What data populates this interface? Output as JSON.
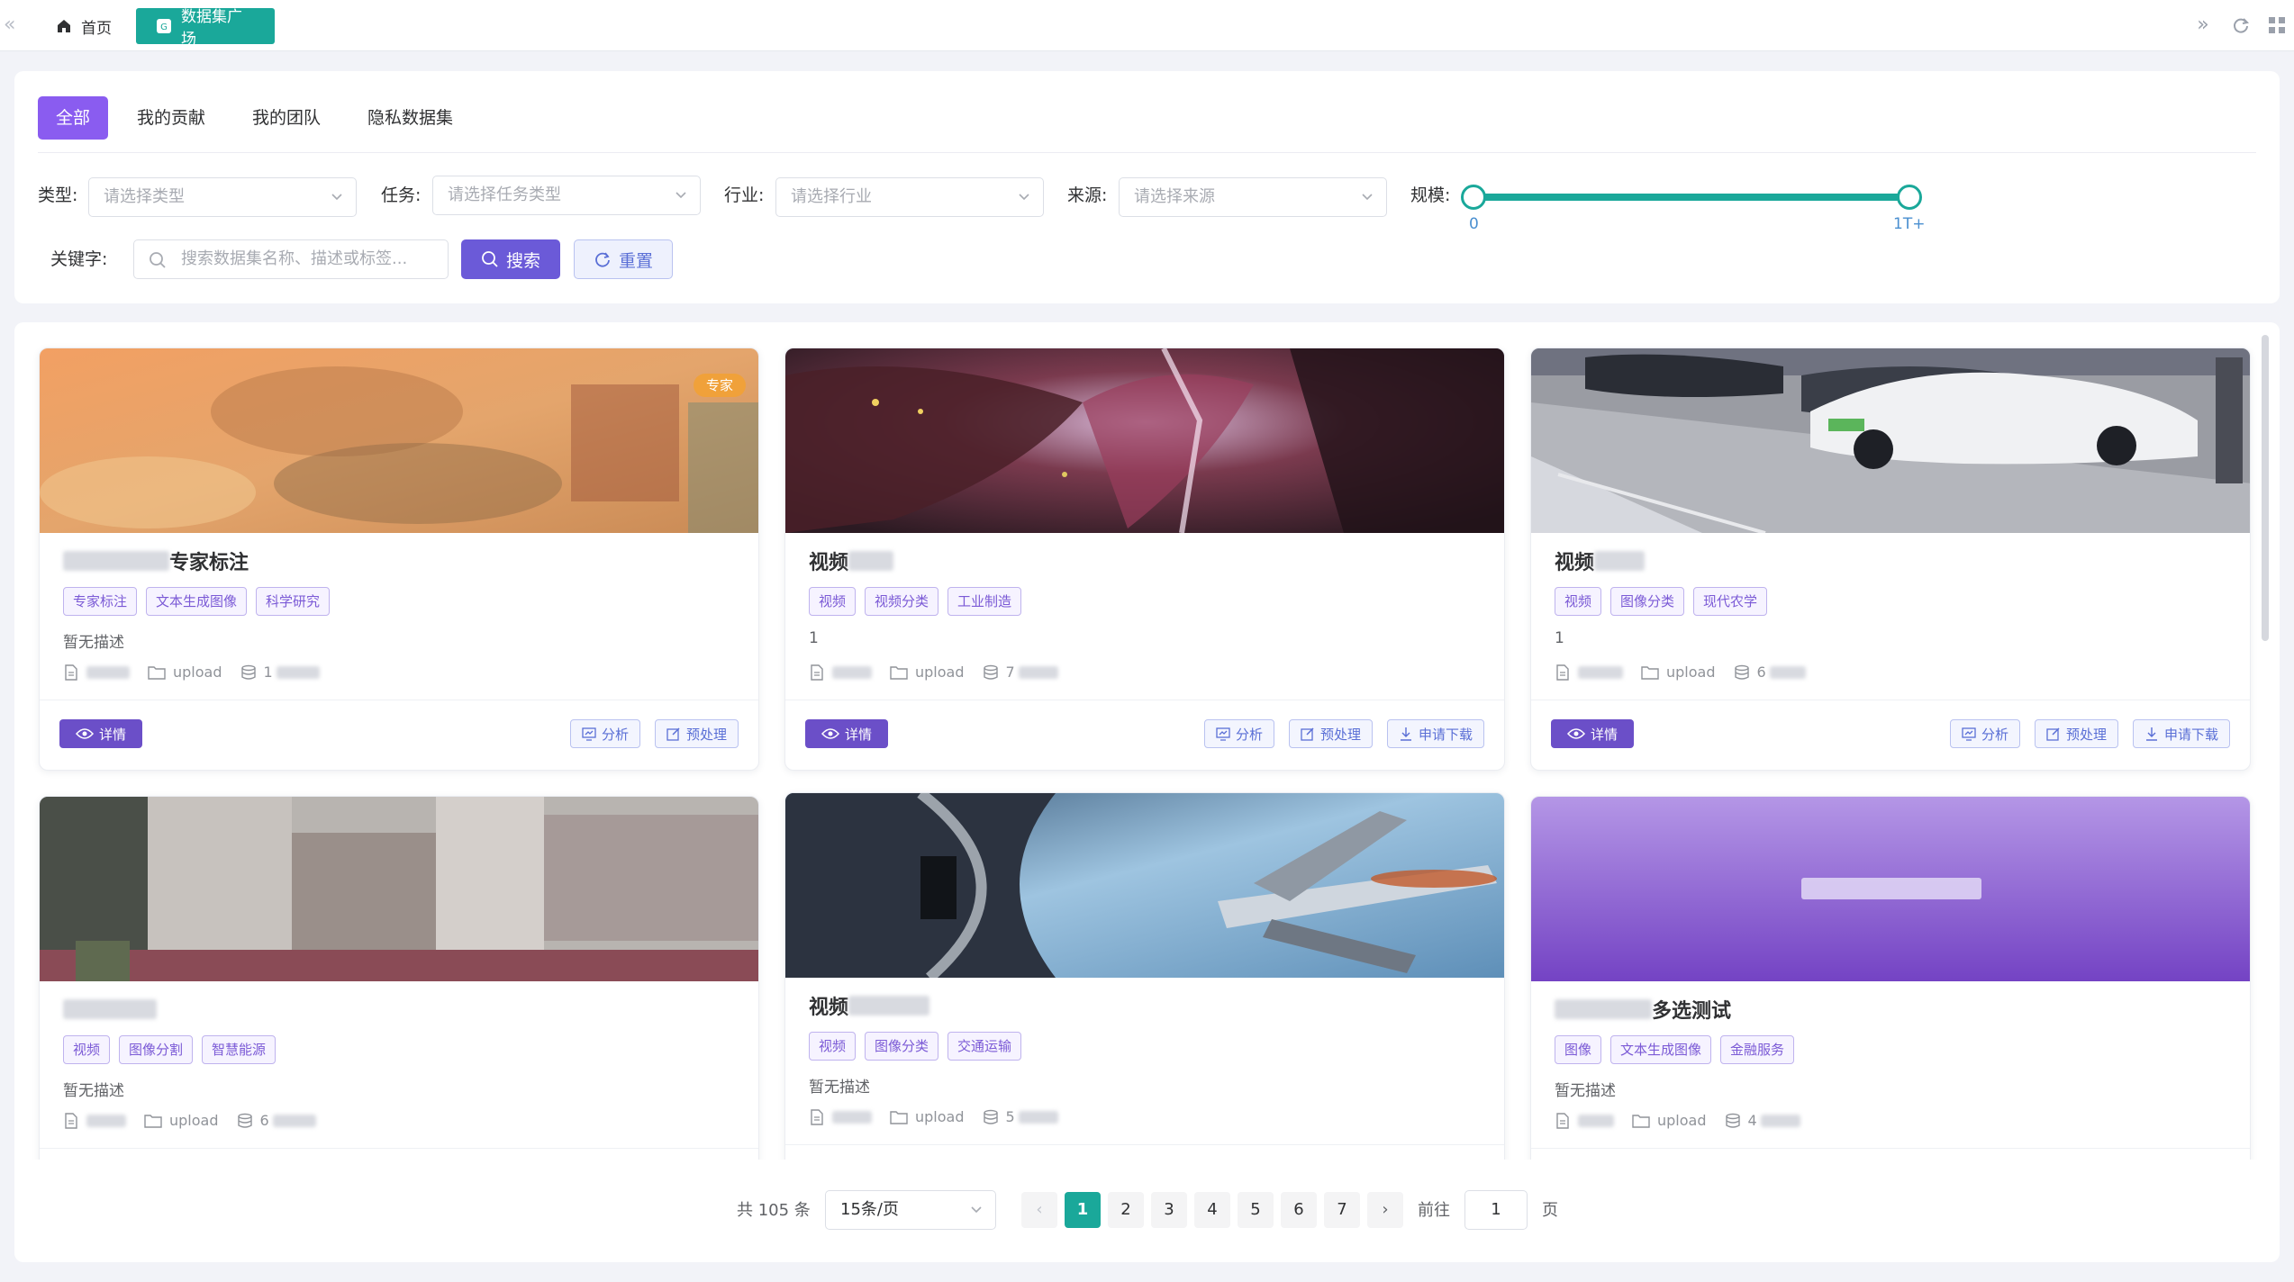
{
  "tabs": [
    {
      "label": "首页",
      "icon": "home-icon"
    },
    {
      "label": "数据集广场",
      "icon": "dataset-icon"
    }
  ],
  "categories": [
    "全部",
    "我的贡献",
    "我的团队",
    "隐私数据集"
  ],
  "filters": {
    "type": {
      "label": "类型:",
      "placeholder": "请选择类型"
    },
    "task": {
      "label": "任务:",
      "placeholder": "请选择任务类型"
    },
    "industry": {
      "label": "行业:",
      "placeholder": "请选择行业"
    },
    "source": {
      "label": "来源:",
      "placeholder": "请选择来源"
    },
    "scale": {
      "label": "规模:",
      "min_label": "0",
      "max_label": "1T+",
      "range_fraction": [
        0.0,
        1.0
      ]
    },
    "keyword": {
      "label": "关键字:",
      "placeholder": "搜索数据集名称、描述或标签..."
    },
    "search_label": "搜索",
    "reset_label": "重置"
  },
  "cards": [
    {
      "title": "专家标注",
      "badge": "专家",
      "tags": [
        "专家标注",
        "文本生成图像",
        "科学研究"
      ],
      "desc": "暂无描述",
      "meta_upload": "upload",
      "meta_size": "1",
      "actions": [
        "分析",
        "预处理"
      ]
    },
    {
      "title": "视频",
      "tags": [
        "视频",
        "视频分类",
        "工业制造"
      ],
      "desc": "1",
      "meta_upload": "upload",
      "meta_size": "7",
      "actions": [
        "分析",
        "预处理",
        "申请下载"
      ]
    },
    {
      "title": "视频",
      "tags": [
        "视频",
        "图像分类",
        "现代农学"
      ],
      "desc": "1",
      "meta_upload": "upload",
      "meta_size": "6",
      "actions": [
        "分析",
        "预处理",
        "申请下载"
      ]
    },
    {
      "title": "",
      "tags": [
        "视频",
        "图像分割",
        "智慧能源"
      ],
      "desc": "暂无描述",
      "meta_upload": "upload",
      "meta_size": "6",
      "actions": []
    },
    {
      "title": "视频",
      "tags": [
        "视频",
        "图像分类",
        "交通运输"
      ],
      "desc": "暂无描述",
      "meta_upload": "upload",
      "meta_size": "5",
      "actions": []
    },
    {
      "title": "多选测试",
      "tags": [
        "图像",
        "文本生成图像",
        "金融服务"
      ],
      "desc": "暂无描述",
      "meta_upload": "upload",
      "meta_size": "4",
      "actions": []
    }
  ],
  "detail_label": "详情",
  "pagination": {
    "total_text": "共 105 条",
    "page_size": "15条/页",
    "pages": [
      "1",
      "2",
      "3",
      "4",
      "5",
      "6",
      "7"
    ],
    "current": "1",
    "goto_label": "前往",
    "goto_value": "1",
    "unit": "页"
  },
  "colors": {
    "primary": "#1aa89a",
    "purple": "#8a5cf0",
    "search": "#6b5ad8"
  }
}
